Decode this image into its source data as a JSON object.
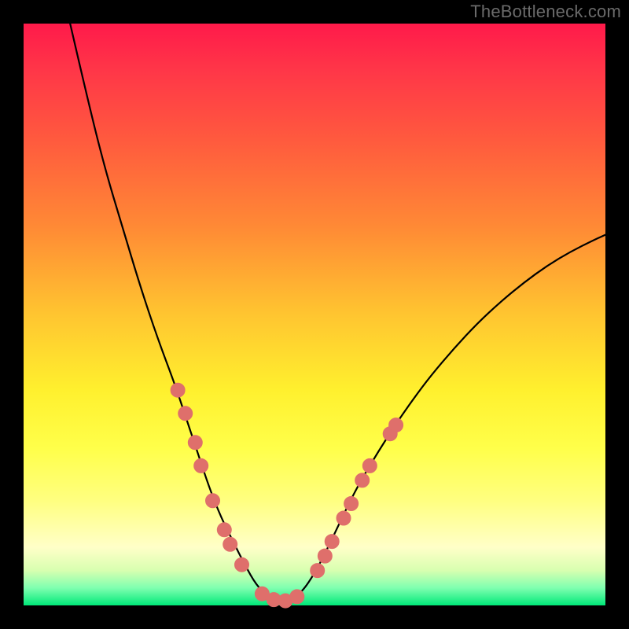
{
  "watermark": "TheBottleneck.com",
  "colors": {
    "frame": "#000000",
    "dot": "#df6f6b",
    "curve": "#000000",
    "gradient_top": "#ff1a4a",
    "gradient_bottom": "#00e878"
  },
  "chart_data": {
    "type": "line",
    "title": "",
    "xlabel": "",
    "ylabel": "",
    "xlim": [
      0,
      100
    ],
    "ylim": [
      0,
      100
    ],
    "note": "X and Y in percent of plot area; Y measured from top edge (0 = top, 100 = bottom). Curve is a V-shaped bottleneck curve; minimum near x≈44.",
    "curve": [
      [
        8,
        0
      ],
      [
        11,
        13
      ],
      [
        14,
        25
      ],
      [
        17,
        35
      ],
      [
        20,
        45
      ],
      [
        23,
        54
      ],
      [
        26,
        62
      ],
      [
        28,
        68
      ],
      [
        30,
        74
      ],
      [
        32,
        80
      ],
      [
        34,
        85
      ],
      [
        36,
        89
      ],
      [
        38,
        93
      ],
      [
        40,
        96.5
      ],
      [
        42,
        98.5
      ],
      [
        44,
        99.3
      ],
      [
        46,
        99.1
      ],
      [
        48,
        97.5
      ],
      [
        50,
        94.5
      ],
      [
        52,
        90.7
      ],
      [
        54,
        86.5
      ],
      [
        56,
        82.3
      ],
      [
        58,
        78.5
      ],
      [
        61,
        73.5
      ],
      [
        64,
        68.8
      ],
      [
        67,
        64.5
      ],
      [
        70,
        60.5
      ],
      [
        74,
        55.8
      ],
      [
        78,
        51.5
      ],
      [
        82,
        47.8
      ],
      [
        86,
        44.5
      ],
      [
        90,
        41.6
      ],
      [
        94,
        39.2
      ],
      [
        98,
        37.2
      ],
      [
        100,
        36.3
      ]
    ],
    "dots_left": [
      [
        26.5,
        63
      ],
      [
        27.8,
        67
      ],
      [
        29.5,
        72
      ],
      [
        30.5,
        76
      ],
      [
        32.5,
        82
      ],
      [
        34.5,
        87
      ],
      [
        35.5,
        89.5
      ],
      [
        37.5,
        93
      ]
    ],
    "dots_bottom": [
      [
        41,
        98
      ],
      [
        43,
        99
      ],
      [
        45,
        99.2
      ],
      [
        47,
        98.5
      ]
    ],
    "dots_right": [
      [
        50.5,
        94
      ],
      [
        51.8,
        91.5
      ],
      [
        53,
        89
      ],
      [
        55,
        85
      ],
      [
        56.3,
        82.5
      ],
      [
        58.2,
        78.5
      ],
      [
        59.5,
        76
      ],
      [
        63,
        70.5
      ],
      [
        64,
        69
      ]
    ]
  }
}
